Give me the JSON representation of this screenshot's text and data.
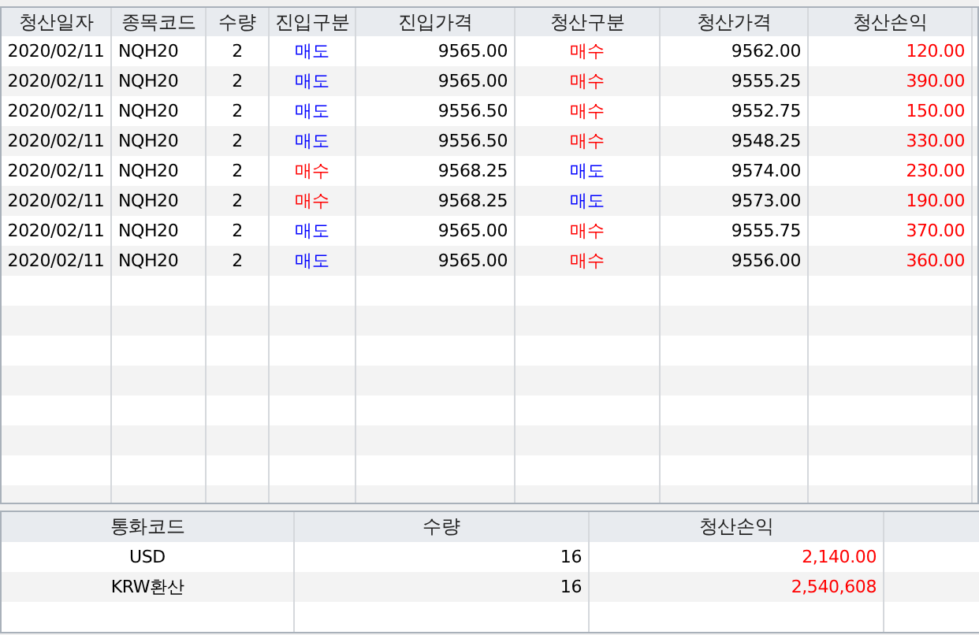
{
  "trades": {
    "columns": [
      "청산일자",
      "종목코드",
      "수량",
      "진입구분",
      "진입가격",
      "청산구분",
      "청산가격",
      "청산손익"
    ],
    "rows": [
      {
        "date": "2020/02/11",
        "code": "NQH20",
        "qty": "2",
        "entry_side": {
          "text": "매도",
          "kind": "sell"
        },
        "entry_price": "9565.00",
        "exit_side": {
          "text": "매수",
          "kind": "buy"
        },
        "exit_price": "9562.00",
        "pnl": "120.00"
      },
      {
        "date": "2020/02/11",
        "code": "NQH20",
        "qty": "2",
        "entry_side": {
          "text": "매도",
          "kind": "sell"
        },
        "entry_price": "9565.00",
        "exit_side": {
          "text": "매수",
          "kind": "buy"
        },
        "exit_price": "9555.25",
        "pnl": "390.00"
      },
      {
        "date": "2020/02/11",
        "code": "NQH20",
        "qty": "2",
        "entry_side": {
          "text": "매도",
          "kind": "sell"
        },
        "entry_price": "9556.50",
        "exit_side": {
          "text": "매수",
          "kind": "buy"
        },
        "exit_price": "9552.75",
        "pnl": "150.00"
      },
      {
        "date": "2020/02/11",
        "code": "NQH20",
        "qty": "2",
        "entry_side": {
          "text": "매도",
          "kind": "sell"
        },
        "entry_price": "9556.50",
        "exit_side": {
          "text": "매수",
          "kind": "buy"
        },
        "exit_price": "9548.25",
        "pnl": "330.00"
      },
      {
        "date": "2020/02/11",
        "code": "NQH20",
        "qty": "2",
        "entry_side": {
          "text": "매수",
          "kind": "buy"
        },
        "entry_price": "9568.25",
        "exit_side": {
          "text": "매도",
          "kind": "sell"
        },
        "exit_price": "9574.00",
        "pnl": "230.00"
      },
      {
        "date": "2020/02/11",
        "code": "NQH20",
        "qty": "2",
        "entry_side": {
          "text": "매수",
          "kind": "buy"
        },
        "entry_price": "9568.25",
        "exit_side": {
          "text": "매도",
          "kind": "sell"
        },
        "exit_price": "9573.00",
        "pnl": "190.00"
      },
      {
        "date": "2020/02/11",
        "code": "NQH20",
        "qty": "2",
        "entry_side": {
          "text": "매도",
          "kind": "sell"
        },
        "entry_price": "9565.00",
        "exit_side": {
          "text": "매수",
          "kind": "buy"
        },
        "exit_price": "9555.75",
        "pnl": "370.00"
      },
      {
        "date": "2020/02/11",
        "code": "NQH20",
        "qty": "2",
        "entry_side": {
          "text": "매도",
          "kind": "sell"
        },
        "entry_price": "9565.00",
        "exit_side": {
          "text": "매수",
          "kind": "buy"
        },
        "exit_price": "9556.00",
        "pnl": "360.00"
      }
    ]
  },
  "summary": {
    "columns": [
      "통화코드",
      "수량",
      "청산손익"
    ],
    "rows": [
      {
        "currency": "USD",
        "qty": "16",
        "pnl": "2,140.00"
      },
      {
        "currency": "KRW환산",
        "qty": "16",
        "pnl": "2,540,608"
      }
    ]
  }
}
